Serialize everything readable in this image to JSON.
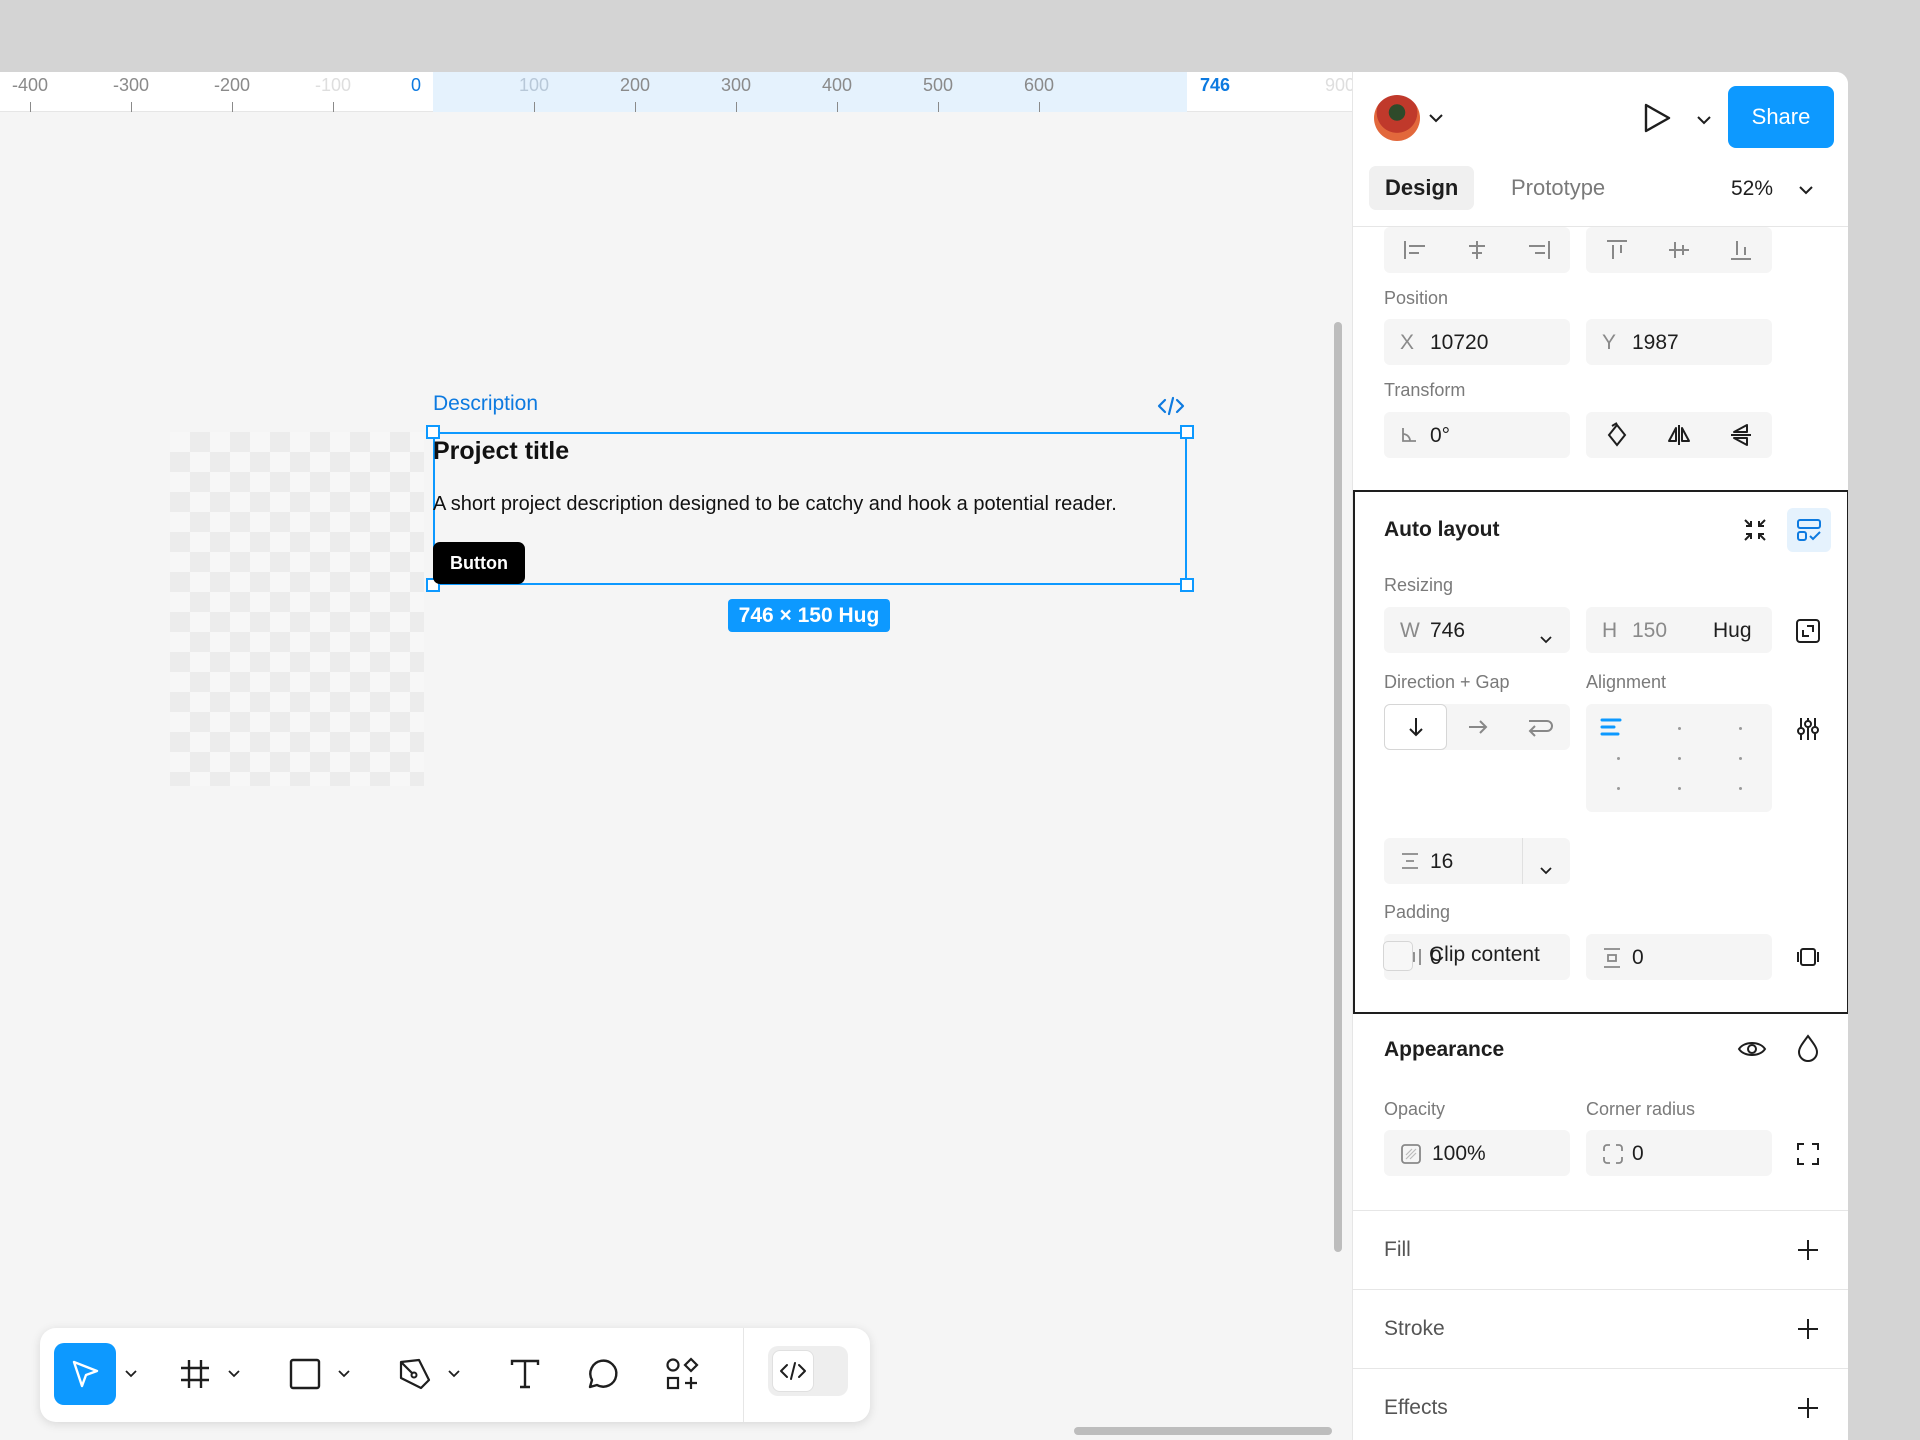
{
  "ruler": {
    "ticks": [
      "-400",
      "-300",
      "-200",
      "-100",
      "0",
      "100",
      "200",
      "300",
      "400",
      "500",
      "600",
      "746",
      "900"
    ]
  },
  "canvas": {
    "frame_name": "Description",
    "project_title": "Project title",
    "project_description": "A short project description designed to be catchy and hook a potential reader.",
    "button_label": "Button",
    "size_badge": "746 × 150 Hug"
  },
  "toolbar": {
    "tools": [
      "move-tool",
      "frame-tool",
      "rectangle-tool",
      "pen-tool",
      "text-tool",
      "comment-tool",
      "actions-tool",
      "dev-mode-toggle"
    ]
  },
  "panel": {
    "share_label": "Share",
    "tabs": [
      "Design",
      "Prototype"
    ],
    "active_tab": "Design",
    "zoom": "52%",
    "position": {
      "label": "Position",
      "x_label": "X",
      "x_value": "10720",
      "y_label": "Y",
      "y_value": "1987"
    },
    "transform": {
      "label": "Transform",
      "rotation": "0°"
    },
    "auto_layout": {
      "title": "Auto layout",
      "resizing_label": "Resizing",
      "w_label": "W",
      "w_value": "746",
      "h_label": "H",
      "h_value": "150",
      "h_mode": "Hug",
      "direction_label": "Direction + Gap",
      "alignment_label": "Alignment",
      "gap_value": "16",
      "padding_label": "Padding",
      "padding_horizontal": "0",
      "padding_vertical": "0",
      "clip_content_label": "Clip content"
    },
    "appearance": {
      "title": "Appearance",
      "opacity_label": "Opacity",
      "opacity_value": "100%",
      "corner_radius_label": "Corner radius",
      "corner_radius_value": "0"
    },
    "fill_label": "Fill",
    "stroke_label": "Stroke",
    "effects_label": "Effects"
  },
  "colors": {
    "accent": "#0d99ff",
    "ruler_accent": "#0d7ae0",
    "canvas_bg": "#f5f5f5"
  }
}
